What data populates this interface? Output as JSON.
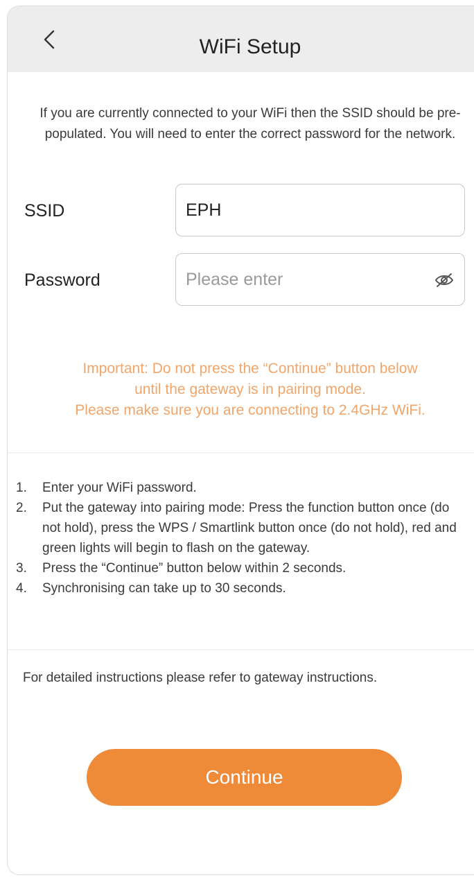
{
  "header": {
    "title": "WiFi Setup"
  },
  "intro_text": "If you are currently connected to your WiFi then the SSID should be pre-populated. You will need to enter the correct password for the network.",
  "form": {
    "ssid_label": "SSID",
    "ssid_value": "EPH",
    "password_label": "Password",
    "password_placeholder": "Please enter",
    "password_value": ""
  },
  "important": {
    "line1": "Important: Do not press the “Continue” button below",
    "line2": "until the gateway is in pairing mode.",
    "line3": "Please make sure you are connecting to 2.4GHz WiFi.",
    "color": "#f0a56a"
  },
  "steps": [
    {
      "num": "1.",
      "text": "Enter your WiFi password."
    },
    {
      "num": "2.",
      "text": "Put the gateway into pairing mode: Press the function button once (do not hold), press the WPS / Smartlink button once (do not hold), red and green lights will begin to flash on the gateway."
    },
    {
      "num": "3.",
      "text": "Press the “Continue” button below within 2 seconds."
    },
    {
      "num": "4.",
      "text": "Synchronising can take up to 30 seconds."
    }
  ],
  "detail_text": "For detailed instructions please refer to gateway instructions.",
  "continue_label": "Continue",
  "icons": {
    "back": "chevron-left-icon",
    "password_toggle": "eye-icon"
  },
  "colors": {
    "accent": "#ee8a38",
    "header_bg": "#ededed"
  }
}
